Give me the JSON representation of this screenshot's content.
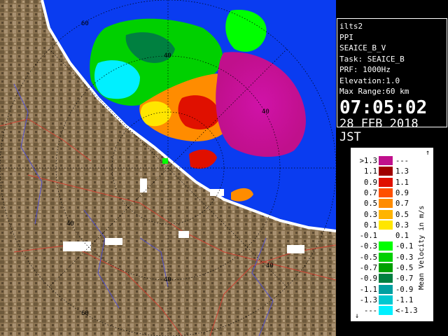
{
  "info": {
    "radar": "ilts2",
    "product": "PPI",
    "field": "SEAICE_B_V",
    "task": "Task: SEAICE_B",
    "prf": "PRF: 1000Hz",
    "elevation": "Elevation:1.0",
    "max_range": "Max Range:60 km",
    "time": "07:05:02",
    "date": "28 FEB 2018 JST"
  },
  "range_labels": [
    "60",
    "40",
    "40",
    "40",
    "40",
    "40",
    "60"
  ],
  "legend": {
    "unit": "Mean Velocity in m/s",
    "rows": [
      {
        "a": ">1.3",
        "b": "---",
        "color": "#c0108c"
      },
      {
        "a": "1.1",
        "b": "1.3",
        "color": "#a00000"
      },
      {
        "a": "0.9",
        "b": "1.1",
        "color": "#e01000"
      },
      {
        "a": "0.7",
        "b": "0.9",
        "color": "#ff5000"
      },
      {
        "a": "0.5",
        "b": "0.7",
        "color": "#ff8c00"
      },
      {
        "a": "0.3",
        "b": "0.5",
        "color": "#ffb400"
      },
      {
        "a": "0.1",
        "b": "0.3",
        "color": "#ffe600"
      },
      {
        "a": "-0.1",
        "b": "0.1",
        "color": "#ffffff"
      },
      {
        "a": "-0.3",
        "b": "-0.1",
        "color": "#00ff00"
      },
      {
        "a": "-0.5",
        "b": "-0.3",
        "color": "#00d000"
      },
      {
        "a": "-0.7",
        "b": "-0.5",
        "color": "#00a000"
      },
      {
        "a": "-0.9",
        "b": "-0.7",
        "color": "#008040"
      },
      {
        "a": "-1.1",
        "b": "-0.9",
        "color": "#00a0a0"
      },
      {
        "a": "-1.3",
        "b": "-1.1",
        "color": "#00c8d0"
      },
      {
        "a": "---",
        "b": "<-1.3",
        "color": "#00f0ff"
      }
    ]
  },
  "colors": {
    "sea": "#0a3cf0",
    "land": "#8a7250",
    "coast": "#ffffff",
    "roads": "#d04030",
    "rivers": "#5050d0"
  }
}
